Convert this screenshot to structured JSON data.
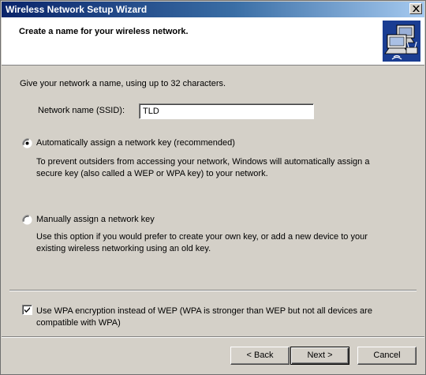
{
  "window": {
    "title": "Wireless Network Setup Wizard"
  },
  "header": {
    "title": "Create a name for your wireless network.",
    "icon": "network-computers-icon"
  },
  "intro": "Give your network a name, using up to 32 characters.",
  "ssid": {
    "label": "Network name (SSID):",
    "value": "TLD"
  },
  "options": [
    {
      "label": "Automatically assign a network key (recommended)",
      "selected": true,
      "description_line1": "To prevent outsiders from accessing your network, Windows will automatically assign a",
      "description_line2": "secure key (also called a WEP or WPA key) to your network."
    },
    {
      "label": "Manually assign a network key",
      "selected": false,
      "description_line1": "Use this option if you would prefer to create your own key, or add a new device to your",
      "description_line2": "existing wireless networking using an old key."
    }
  ],
  "wpa": {
    "checked": true,
    "label_line1": "Use WPA encryption instead of WEP (WPA is stronger than WEP but not all devices are",
    "label_line2": "compatible with WPA)"
  },
  "buttons": {
    "back": "< Back",
    "next": "Next >",
    "cancel": "Cancel"
  },
  "colors": {
    "titlebar_start": "#0a246a",
    "titlebar_end": "#a6caf0",
    "dialog_face": "#d4d0c8",
    "header_bg": "#ffffff",
    "icon_bg": "#1a3d92"
  }
}
